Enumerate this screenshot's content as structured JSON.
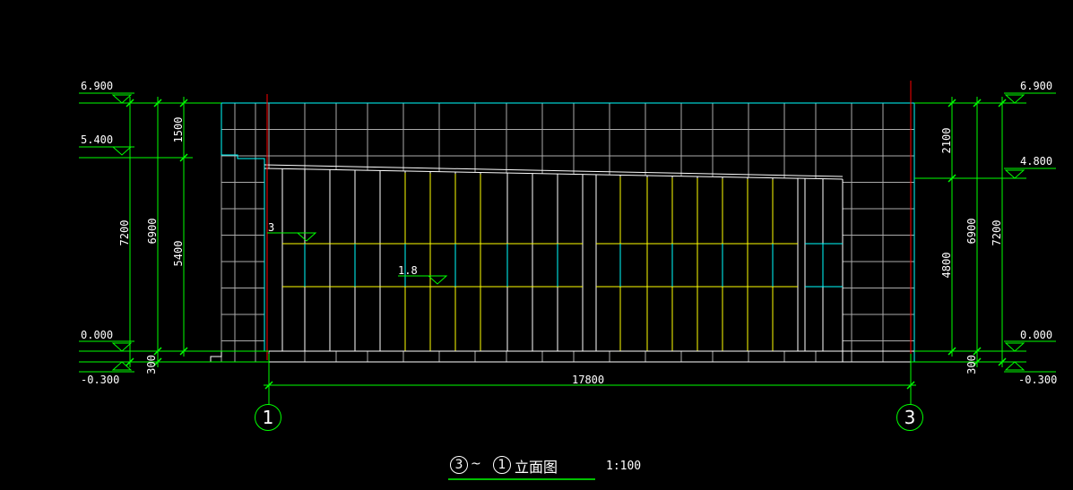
{
  "elevations": {
    "left_top": "6.900",
    "left_mid": "5.400",
    "left_ground": "0.000",
    "left_base": "-0.300",
    "right_top": "6.900",
    "right_mid": "4.800",
    "right_ground": "0.000",
    "right_base": "-0.300"
  },
  "dimensions": {
    "left_outer": "7200",
    "left_inner": "6900",
    "left_upper": "1500",
    "left_lower": "5400",
    "left_plinth": "300",
    "right_outer": "7200",
    "right_inner": "6900",
    "right_upper": "2100",
    "right_lower": "4800",
    "right_plinth": "300",
    "horizontal": "17800"
  },
  "levels": {
    "level_a": "3",
    "level_b": "1.8"
  },
  "axes": {
    "left": "1",
    "right": "3"
  },
  "title": {
    "from_axis": "3",
    "separator": "~",
    "to_axis": "1",
    "name": "立面图",
    "scale": "1:100"
  },
  "colors": {
    "background": "#000000",
    "dimension": "#00ff00",
    "outline": "#ffffff",
    "grid": "#aaaaaa",
    "cyan": "#00ffff",
    "yellow": "#ffff00",
    "axis_red": "#ff0000"
  }
}
